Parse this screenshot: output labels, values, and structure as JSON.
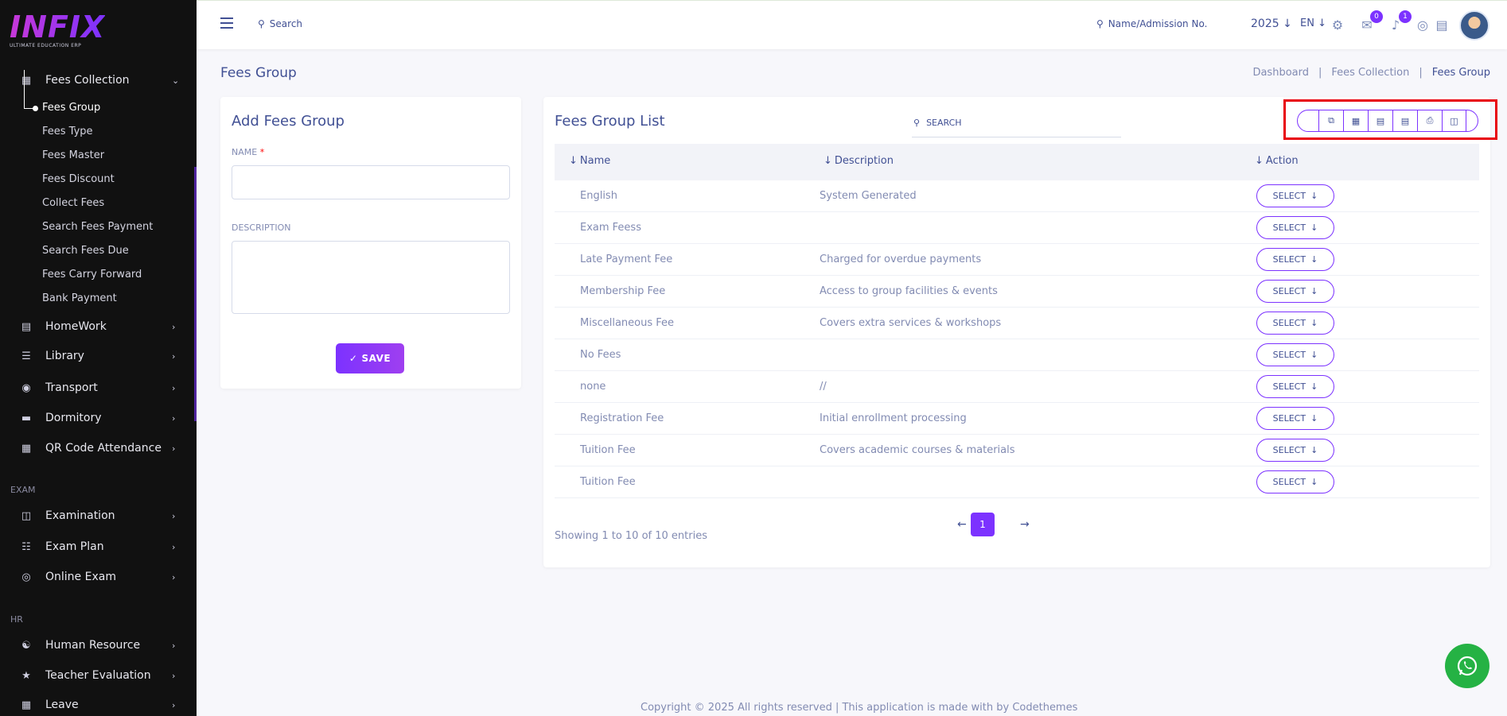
{
  "brand": {
    "logo_text": "INFIX",
    "tagline": "ULTIMATE EDUCATION ERP"
  },
  "sidebar": {
    "fees_collection": "Fees Collection",
    "fees_sub": [
      "Fees Group",
      "Fees Type",
      "Fees Master",
      "Fees Discount",
      "Collect Fees",
      "Search Fees Payment",
      "Search Fees Due",
      "Fees Carry Forward",
      "Bank Payment"
    ],
    "groups": [
      "HomeWork",
      "Library",
      "Transport",
      "Dormitory",
      "QR Code Attendance"
    ],
    "exam_section": "EXAM",
    "exam_items": [
      "Examination",
      "Exam Plan",
      "Online Exam"
    ],
    "hr_section": "HR",
    "hr_items": [
      "Human Resource",
      "Teacher Evaluation",
      "Leave"
    ]
  },
  "topbar": {
    "search_label": "Search",
    "name_search_label": "Name/Admission No.",
    "year": "2025",
    "lang": "EN",
    "chat_count": "0",
    "notif_count": "1"
  },
  "page": {
    "title": "Fees Group",
    "breadcrumb": [
      "Dashboard",
      "Fees Collection",
      "Fees Group"
    ]
  },
  "form": {
    "title": "Add Fees Group",
    "name_label": "NAME",
    "required_mark": "*",
    "description_label": "DESCRIPTION",
    "save_label": "SAVE"
  },
  "list": {
    "title": "Fees Group List",
    "search_label": "SEARCH",
    "columns": [
      "Name",
      "Description",
      "Action"
    ],
    "rows": [
      {
        "name": "English",
        "description": "System Generated"
      },
      {
        "name": "Exam Feess",
        "description": ""
      },
      {
        "name": "Late Payment Fee",
        "description": "Charged for overdue payments"
      },
      {
        "name": "Membership Fee",
        "description": "Access to group facilities & events"
      },
      {
        "name": "Miscellaneous Fee",
        "description": "Covers extra services & workshops"
      },
      {
        "name": "No Fees",
        "description": ""
      },
      {
        "name": "none",
        "description": "//"
      },
      {
        "name": "Registration Fee",
        "description": "Initial enrollment processing"
      },
      {
        "name": "Tuition Fee",
        "description": "Covers academic courses & materials"
      },
      {
        "name": "Tuition Fee",
        "description": ""
      }
    ],
    "select_label": "SELECT",
    "entries_text": "Showing 1 to 10 of 10 entries",
    "current_page": "1"
  },
  "footer": {
    "text": "Copyright © 2025 All rights reserved | This application is made with by Codethemes"
  },
  "colors": {
    "accent": "#7c32ff",
    "sidebar_bg": "#111111",
    "text": "#415094",
    "highlight": "#e8000b"
  }
}
